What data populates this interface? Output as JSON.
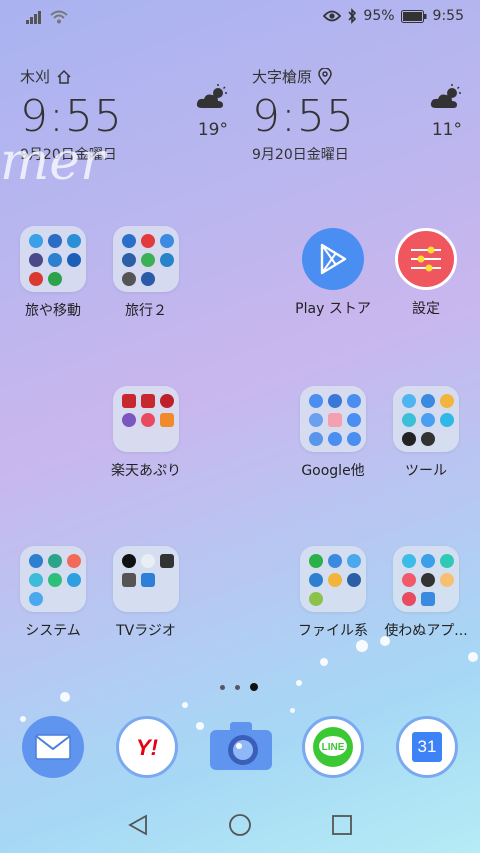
{
  "status_bar": {
    "battery_pct": "95%",
    "time": "9:55"
  },
  "clock_widgets": [
    {
      "city": "木刈",
      "time": "9:55",
      "date": "9月20日金曜日",
      "temp": "19°"
    },
    {
      "city": "大字槍原",
      "time": "9:55",
      "date": "9月20日金曜日",
      "temp": "11°"
    }
  ],
  "apps": {
    "travel": "旅や移動",
    "travel2": "旅行２",
    "play_store": "Play ストア",
    "settings": "設定",
    "rakuten": "楽天あぷり",
    "google": "Google他",
    "tools": "ツール",
    "system": "システム",
    "tv_radio": "TVラジオ",
    "file": "ファイル系",
    "unused": "使わぬアプ..."
  },
  "dock": {
    "calendar_day": "31"
  },
  "page_indicator": {
    "pages": 3,
    "active": 3
  },
  "colors": {
    "accent_blue": "#3e82f7",
    "line_green": "#3ac935",
    "yahoo_red": "#e60012"
  }
}
